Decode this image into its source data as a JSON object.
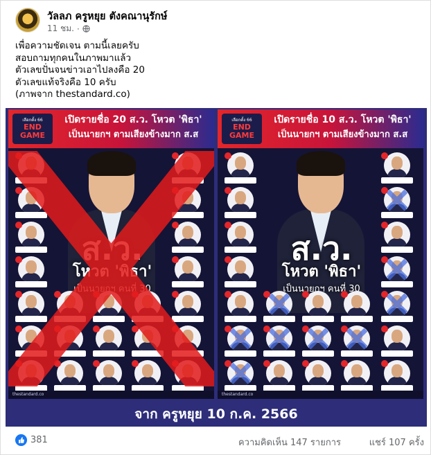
{
  "post": {
    "author": "วัลลภ ครูหยุย ตังคณานุรักษ์",
    "time": "11 ชม.",
    "privacy_icon": "globe-icon",
    "lines": [
      "เพื่อความชัดเจน ตามนี้เลยครับ",
      "สอบถามทุกคนในภาพมาแล้ว",
      "ตัวเลขปั่นจนข่าวเอาไปลงคือ 20",
      "ตัวเลขแท้จริงคือ 10 ครับ",
      "(ภาพจาก thestandard.co)"
    ]
  },
  "image": {
    "left": {
      "logo_top": "เลือกตั้ง 66",
      "logo_mid": "END",
      "logo_bot": "GAME",
      "heading1": "เปิดรายชื่อ 20 ส.ว. โหวต 'พิธา'",
      "heading2": "เป็นนายกฯ ตามเสียงข้างมาก ส.ส",
      "big": "ส.ว.",
      "vote": "โหวต 'พิธา'",
      "pm": "เป็นนายกฯ คนที่ 30",
      "foot": "thestandard.co"
    },
    "right": {
      "logo_top": "เลือกตั้ง 66",
      "logo_mid": "END",
      "logo_bot": "GAME",
      "heading1": "เปิดรายชื่อ 10 ส.ว. โหวต 'พิธา'",
      "heading2": "เป็นนายกฯ ตามเสียงข้างมาก ส.ส",
      "big": "ส.ว.",
      "vote": "โหวต 'พิธา'",
      "pm": "เป็นนายกฯ คนที่ 30",
      "foot": "thestandard.co"
    },
    "source": "จาก ครูหยุย 10 ก.ค. 2566"
  },
  "stats": {
    "like_icon": "thumbs-up-icon",
    "likes": "381",
    "comments": "ความคิดเห็น 147 รายการ",
    "shares": "แชร์ 107 ครั้ง"
  },
  "colors": {
    "poster_bg": "#141436",
    "ribbon_red": "#e3262a",
    "frame_blue": "#2d2d7a",
    "cross_red": "#e31b1b",
    "cross_blue": "#4a6fe0",
    "fb_blue": "#1877f2"
  }
}
